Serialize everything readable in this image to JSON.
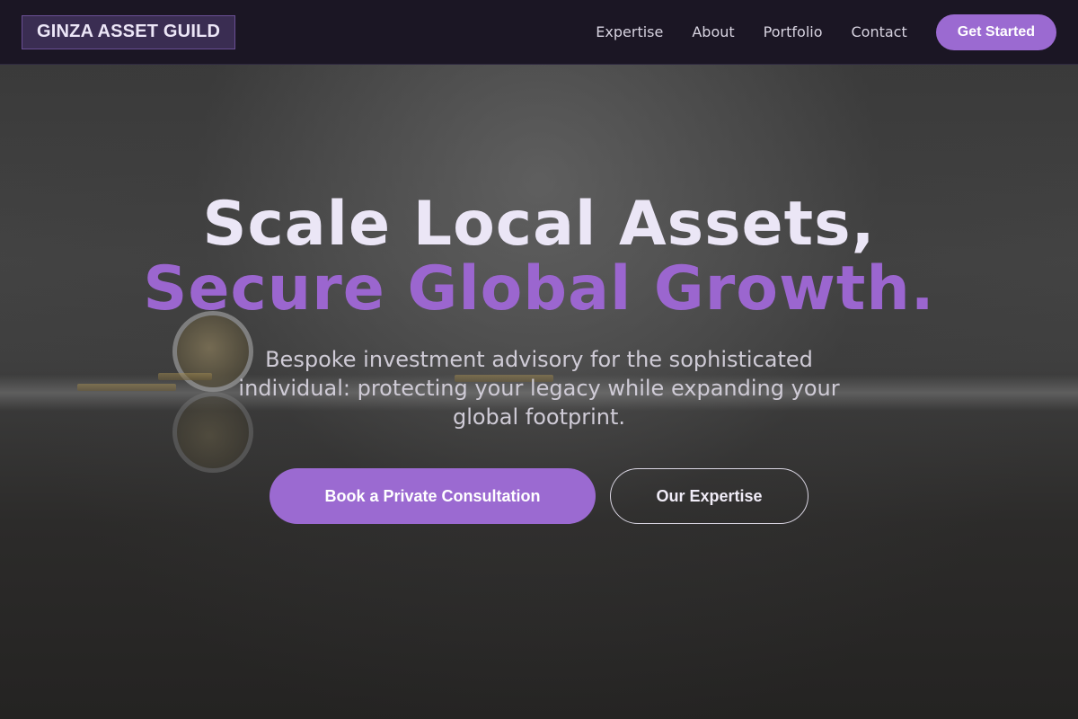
{
  "header": {
    "logo_text": "GINZA ASSET GUILD",
    "nav": [
      "Expertise",
      "About",
      "Portfolio",
      "Contact"
    ],
    "cta_label": "Get Started"
  },
  "hero": {
    "headline_line1": "Scale Local Assets,",
    "headline_line2": "Secure Global Growth.",
    "subtitle": "Bespoke investment advisory for the sophisticated individual: protecting your legacy while expanding your global footprint.",
    "primary_button": "Book a Private Consultation",
    "secondary_button": "Our Expertise"
  },
  "colors": {
    "accent": "#9b6ad1",
    "header_bg": "#1b1624",
    "headline_primary": "#ebe6f6",
    "headline_accent": "#9b66cf"
  }
}
